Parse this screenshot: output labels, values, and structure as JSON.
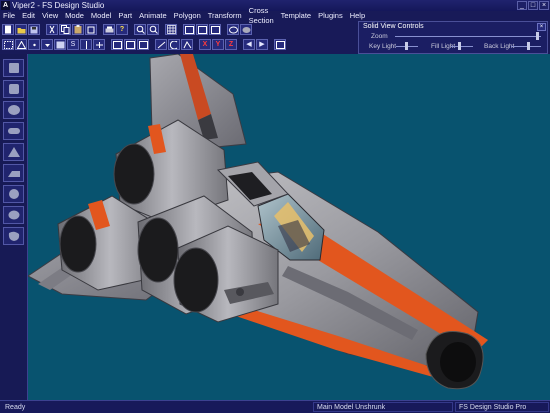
{
  "window": {
    "title": "Viper2 - FS Design Studio",
    "app_icon_glyph": "A"
  },
  "menu": [
    "File",
    "Edit",
    "View",
    "Mode",
    "Model",
    "Part",
    "Animate",
    "Polygon",
    "Transform",
    "Cross Section",
    "Template",
    "Plugins",
    "Help"
  ],
  "toolbar": {
    "scale_label": "S",
    "axis_x": "X",
    "axis_y": "Y",
    "axis_z": "Z",
    "prev_arrow": "◀",
    "next_arrow": "▶"
  },
  "solid_view_controls": {
    "title": "Solid View Controls",
    "close": "×",
    "zoom_label": "Zoom",
    "key_light_label": "Key Light",
    "fill_light_label": "Fill Light",
    "back_light_label": "Back Light",
    "zoom": 0.95
  },
  "status": {
    "left": "Ready",
    "model": "Main Model Unshrunk",
    "product": "FS Design Studio Pro"
  },
  "colors": {
    "viewport_bg": "#08536f",
    "hull": "#8c8c90",
    "stripe": "#e2561e",
    "engine_dark": "#1b1b1d"
  }
}
